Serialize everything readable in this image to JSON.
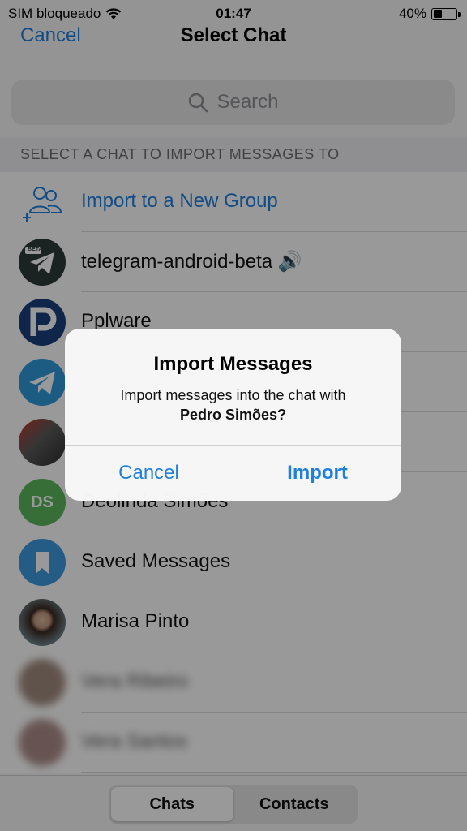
{
  "status_bar": {
    "carrier": "SIM bloqueado",
    "time": "01:47",
    "battery": "40%",
    "battery_level": 0.4
  },
  "nav": {
    "cancel_label": "Cancel",
    "title": "Select Chat"
  },
  "search": {
    "placeholder": "Search"
  },
  "section_header": "SELECT A CHAT TO IMPORT MESSAGES TO",
  "rows": [
    {
      "label": "Import to a New Group",
      "icon": "add-group-icon"
    },
    {
      "label": "telegram-android-beta 🔊",
      "avatar": "BETA"
    },
    {
      "label": "Pplware"
    },
    {
      "label": ""
    },
    {
      "label": ""
    },
    {
      "label": "Deolinda Simões",
      "avatar": "DS"
    },
    {
      "label": "Saved Messages",
      "icon": "bookmark-icon"
    },
    {
      "label": "Marisa Pinto"
    },
    {
      "label": "Vera Ribeiro"
    },
    {
      "label": "Vera Santos"
    }
  ],
  "tabs": {
    "chats": "Chats",
    "contacts": "Contacts",
    "active": "Chats"
  },
  "alert": {
    "title": "Import Messages",
    "message_prefix": "Import messages into the chat with",
    "message_name": "Pedro Simões?",
    "cancel_label": "Cancel",
    "import_label": "Import"
  },
  "colors": {
    "accent": "#1f7fe0",
    "ds_avatar": "#5cb85c",
    "pplware": "#1a3e7a",
    "telegram_blue": "#2f9ad9"
  }
}
